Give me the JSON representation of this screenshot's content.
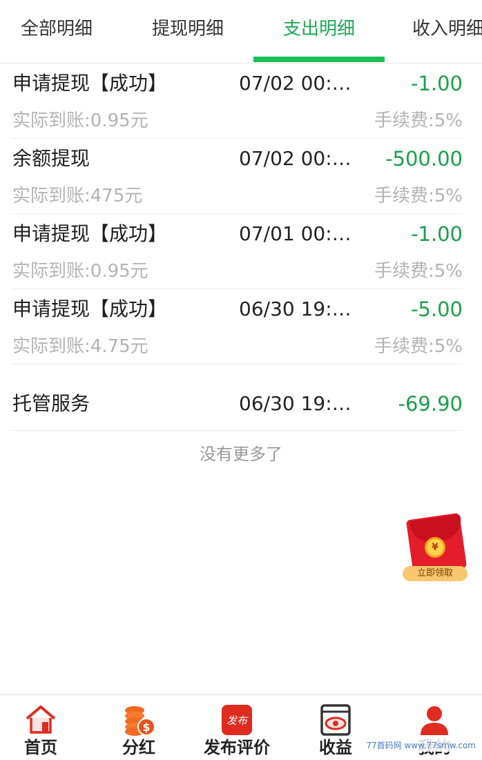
{
  "tabs": [
    {
      "label": "全部明细",
      "active": false
    },
    {
      "label": "提现明细",
      "active": false
    },
    {
      "label": "支出明细",
      "active": true
    },
    {
      "label": "收入明细",
      "active": false
    }
  ],
  "records": [
    {
      "title": "申请提现【成功】",
      "time": "07/02 00:…",
      "amount": "-1.00",
      "actual": "实际到账:0.95元",
      "fee": "手续费:5%"
    },
    {
      "title": "余额提现",
      "time": "07/02 00:…",
      "amount": "-500.00",
      "actual": "实际到账:475元",
      "fee": "手续费:5%"
    },
    {
      "title": "申请提现【成功】",
      "time": "07/01 00:…",
      "amount": "-1.00",
      "actual": "实际到账:0.95元",
      "fee": "手续费:5%"
    },
    {
      "title": "申请提现【成功】",
      "time": "06/30 19:…",
      "amount": "-5.00",
      "actual": "实际到账:4.75元",
      "fee": "手续费:5%"
    },
    {
      "title": "托管服务",
      "time": "06/30 19:…",
      "amount": "-69.90"
    }
  ],
  "no_more_text": "没有更多了",
  "red_packet": {
    "coin_symbol": "¥",
    "label": "立即领取"
  },
  "bottom_nav": [
    {
      "label": "首页",
      "icon": "home-icon"
    },
    {
      "label": "分红",
      "icon": "coins-icon"
    },
    {
      "label": "发布评价",
      "icon": "publish-icon",
      "icon_text": "发布"
    },
    {
      "label": "收益",
      "icon": "earnings-icon"
    },
    {
      "label": "我的",
      "icon": "profile-icon"
    }
  ],
  "watermark": "77首码网 www.77smw.com",
  "colors": {
    "accent_green": "#1bbf5a",
    "amount_green": "#1aa04a",
    "nav_red": "#e02b20"
  }
}
